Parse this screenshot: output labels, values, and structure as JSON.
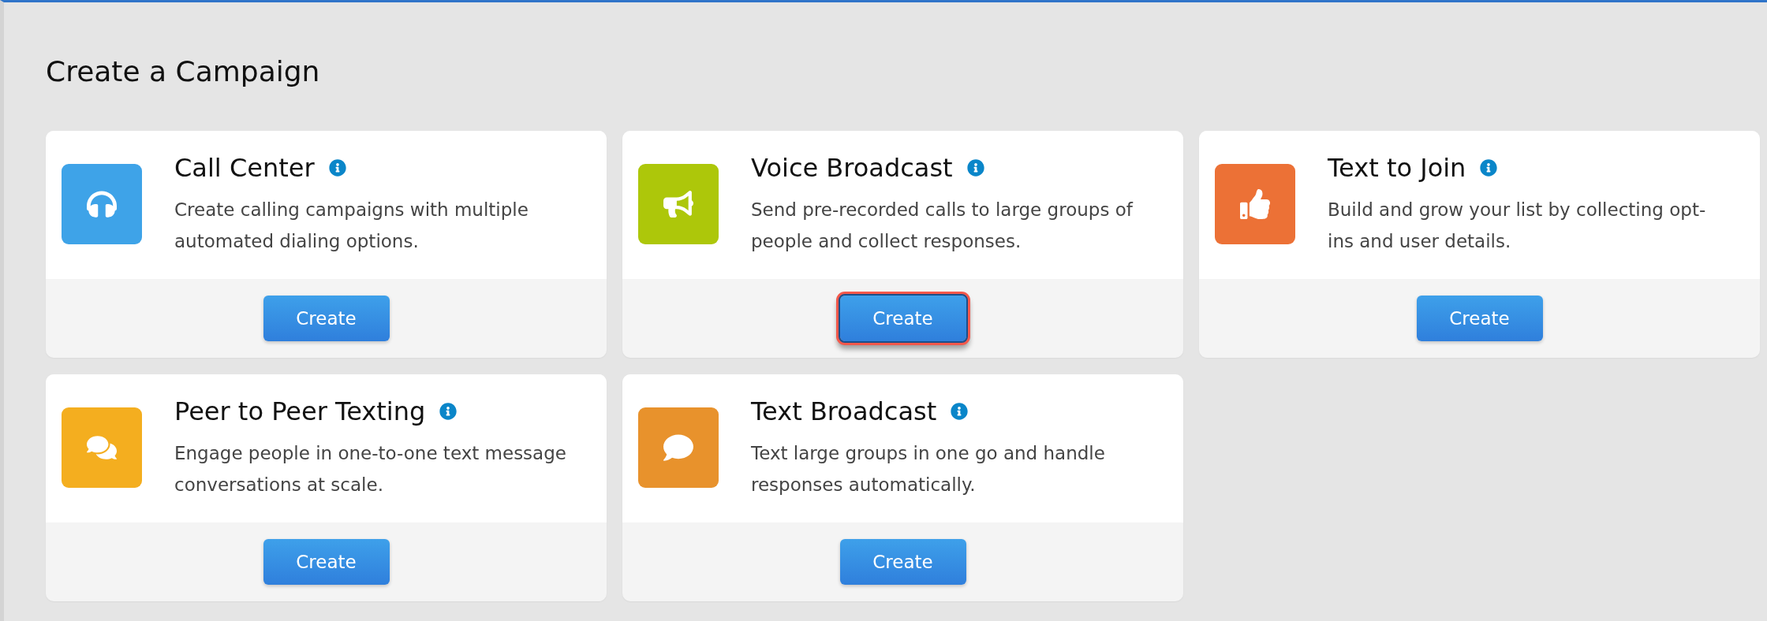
{
  "page": {
    "title": "Create a Campaign"
  },
  "cards": [
    {
      "title": "Call Center",
      "description": "Create calling campaigns with multiple automated dialing options.",
      "button": "Create",
      "color": "#3ea3e8",
      "highlighted": false
    },
    {
      "title": "Voice Broadcast",
      "description": "Send pre-recorded calls to large groups of people and collect responses.",
      "button": "Create",
      "color": "#adc70a",
      "highlighted": true
    },
    {
      "title": "Text to Join",
      "description": "Build and grow your list by collecting opt-ins and user details.",
      "button": "Create",
      "color": "#ec7136",
      "highlighted": false
    },
    {
      "title": "Peer to Peer Texting",
      "description": "Engage people in one-to-one text message conversations at scale.",
      "button": "Create",
      "color": "#f4ae1f",
      "highlighted": false
    },
    {
      "title": "Text Broadcast",
      "description": "Text large groups in one go and handle responses automatically.",
      "button": "Create",
      "color": "#e8922c",
      "highlighted": false
    }
  ]
}
